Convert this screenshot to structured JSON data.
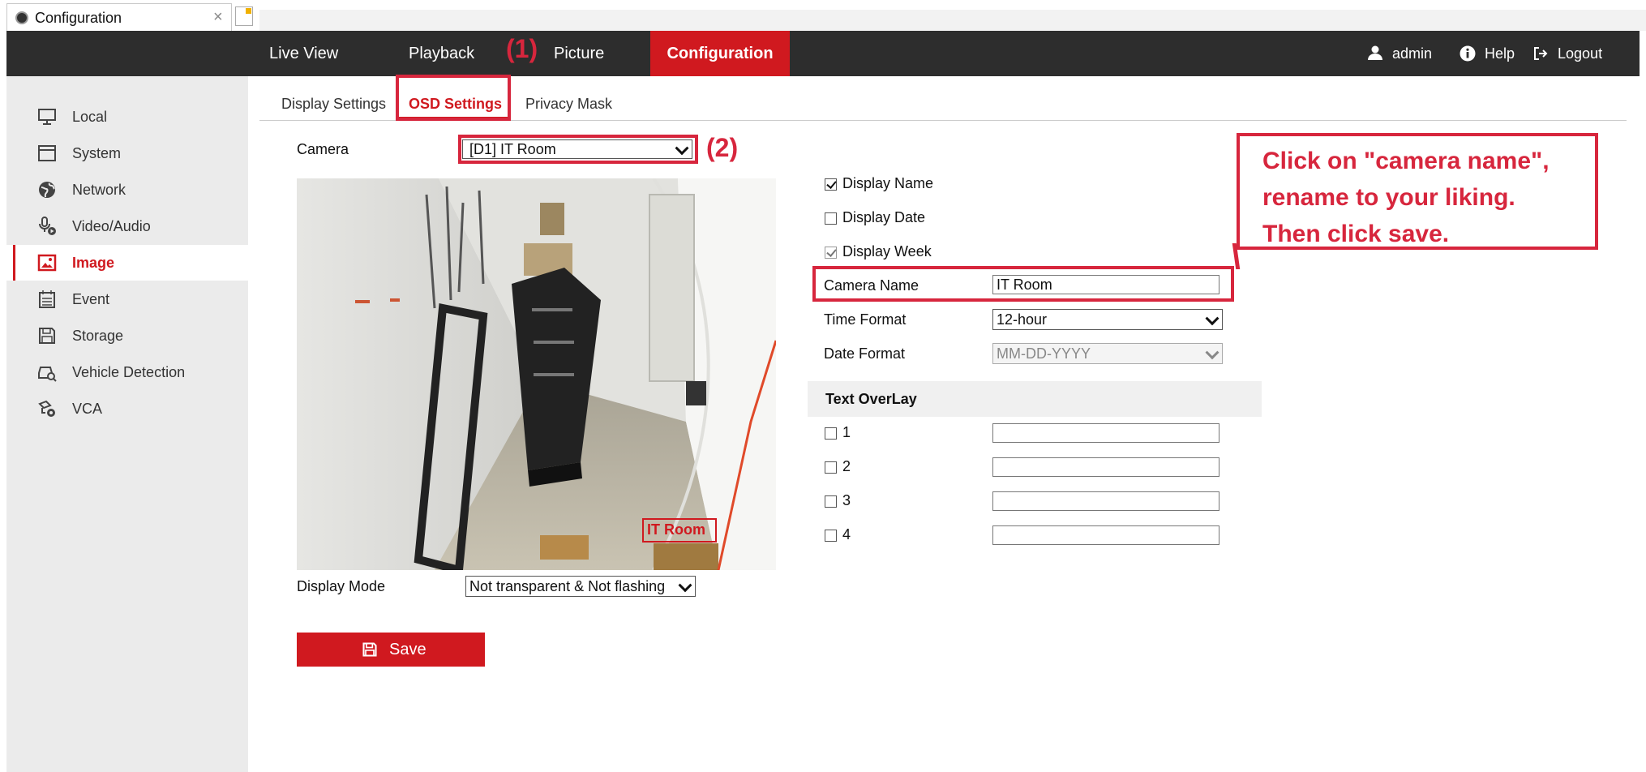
{
  "browser": {
    "tab_title": "Configuration",
    "close_glyph": "×"
  },
  "topnav": {
    "items": [
      "Live View",
      "Playback",
      "Picture",
      "Configuration"
    ],
    "active": "Configuration",
    "user": "admin",
    "help": "Help",
    "logout": "Logout"
  },
  "sidebar": {
    "items": [
      {
        "label": "Local",
        "icon": "monitor-icon"
      },
      {
        "label": "System",
        "icon": "system-icon"
      },
      {
        "label": "Network",
        "icon": "globe-icon"
      },
      {
        "label": "Video/Audio",
        "icon": "video-audio-icon"
      },
      {
        "label": "Image",
        "icon": "image-icon"
      },
      {
        "label": "Event",
        "icon": "calendar-icon"
      },
      {
        "label": "Storage",
        "icon": "floppy-icon"
      },
      {
        "label": "Vehicle Detection",
        "icon": "vehicle-detection-icon"
      },
      {
        "label": "VCA",
        "icon": "vca-icon"
      }
    ],
    "active": "Image"
  },
  "subtabs": {
    "items": [
      "Display Settings",
      "OSD Settings",
      "Privacy Mask"
    ],
    "active": "OSD Settings"
  },
  "form": {
    "camera_label": "Camera",
    "camera_value": "[D1] IT Room",
    "display_mode_label": "Display Mode",
    "display_mode_value": "Not transparent & Not flashing",
    "display_name_label": "Display Name",
    "display_name_checked": true,
    "display_date_label": "Display Date",
    "display_date_checked": false,
    "display_week_label": "Display Week",
    "display_week_checked": true,
    "camera_name_label": "Camera Name",
    "camera_name_value": "IT Room",
    "time_format_label": "Time Format",
    "time_format_value": "12-hour",
    "date_format_label": "Date Format",
    "date_format_value": "MM-DD-YYYY",
    "text_overlay_header": "Text OverLay",
    "overlays": [
      {
        "label": "1",
        "value": ""
      },
      {
        "label": "2",
        "value": ""
      },
      {
        "label": "3",
        "value": ""
      },
      {
        "label": "4",
        "value": ""
      }
    ],
    "save_label": "Save"
  },
  "preview": {
    "osd_text": "IT Room"
  },
  "annotations": {
    "step1": "(1)",
    "step2": "(2)",
    "instruction": [
      "Click on \"camera name\",",
      "rename to your liking.",
      "Then click save."
    ]
  },
  "colors": {
    "accent": "#d0191f",
    "annotation": "#d7263d",
    "nav_bg": "#2d2d2d",
    "sidebar_bg": "#ebebeb"
  }
}
